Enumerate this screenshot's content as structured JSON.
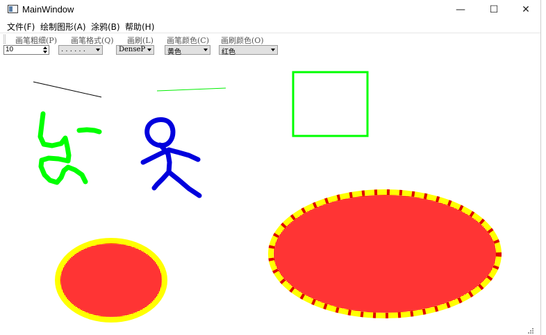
{
  "window": {
    "title": "MainWindow"
  },
  "window_controls": {
    "minimize": "—",
    "maximize": "☐",
    "close": "✕"
  },
  "menu": {
    "file": "文件(F)",
    "draw_shape": "绘制图形(A)",
    "doodle": "涂鸦(B)",
    "help": "帮助(H)"
  },
  "toolbar": {
    "pen_width_label": "画笔粗细(P)",
    "pen_style_label": "画笔格式(Q)",
    "brush_label": "画刷(L)",
    "pen_color_label": "画笔颜色(C)",
    "brush_color_label": "画刷颜色(O)",
    "pen_width_value": "10",
    "pen_style_value": ". . . . . .",
    "brush_value": "DensePa",
    "pen_color_value": "黄色",
    "brush_color_value": "红色"
  },
  "colors": {
    "pen": "#ffff00",
    "brush": "#ff0000",
    "green": "#00ff00",
    "blue": "#0000dd",
    "black": "#000000"
  },
  "icons": [
    "app-window-icon",
    "spin-up-icon",
    "spin-down-icon",
    "dropdown-arrow-icon",
    "resize-grip-icon"
  ]
}
